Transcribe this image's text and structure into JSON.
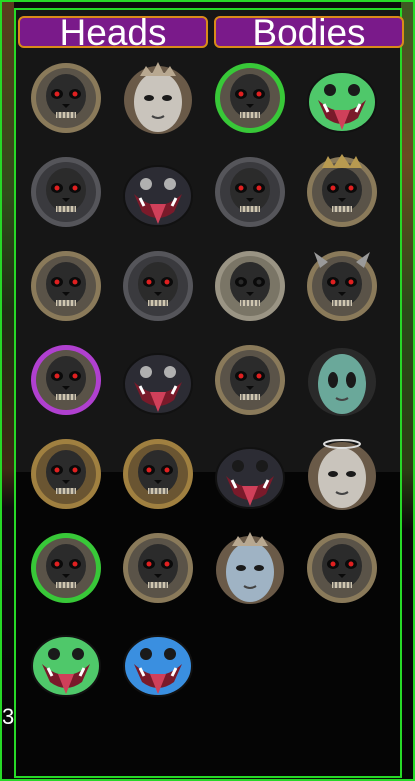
{
  "tabs": {
    "heads_label": "Heads",
    "bodies_label": "Bodies"
  },
  "edge_text": "3",
  "colors": {
    "frame": "#27d927",
    "tab_fill": "#7a1a8a",
    "tab_border": "#d98b1a"
  },
  "heads": [
    {
      "icon": "helmeted-skull-icon"
    },
    {
      "icon": "crowned-pale-face-icon"
    },
    {
      "icon": "green-ring-demon-icon"
    },
    {
      "icon": "green-serpent-icon"
    },
    {
      "icon": "scaled-orb-face-icon"
    },
    {
      "icon": "dark-cobra-icon"
    },
    {
      "icon": "scaled-reptile-head-icon"
    },
    {
      "icon": "crowned-skull-icon"
    },
    {
      "icon": "red-eyed-skull-icon"
    },
    {
      "icon": "scaled-dark-face-icon"
    },
    {
      "icon": "stone-skull-icon"
    },
    {
      "icon": "horned-red-demon-icon"
    },
    {
      "icon": "purple-ring-skull-icon"
    },
    {
      "icon": "dark-cobra-icon"
    },
    {
      "icon": "ornate-skull-icon"
    },
    {
      "icon": "alien-face-icon"
    },
    {
      "icon": "bronze-skull-icon"
    },
    {
      "icon": "golden-skull-icon"
    },
    {
      "icon": "scaled-cobra-head-icon"
    },
    {
      "icon": "haloed-marble-face-icon"
    },
    {
      "icon": "green-ring-skull-icon"
    },
    {
      "icon": "helmeted-red-skull-icon"
    },
    {
      "icon": "crowned-crystal-face-icon"
    },
    {
      "icon": "reptile-head-icon"
    },
    {
      "icon": "green-serpent-icon"
    },
    {
      "icon": "blue-serpent-icon"
    }
  ]
}
